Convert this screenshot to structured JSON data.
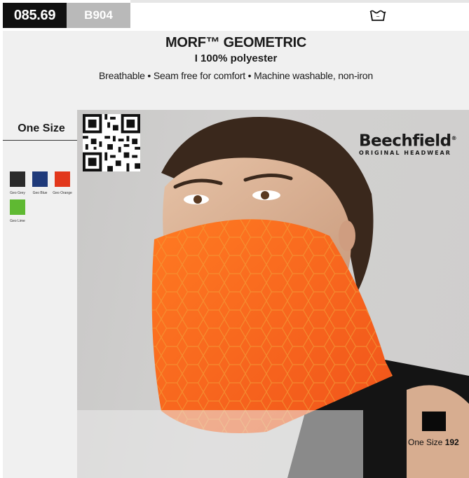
{
  "header": {
    "product_code": "085.69",
    "sku": "B904"
  },
  "product": {
    "title": "MORF™ GEOMETRIC",
    "material": "I 100% polyester",
    "features": "Breathable • Seam free for comfort • Machine washable, non-iron"
  },
  "sidebar": {
    "size_heading": "One Size",
    "colours": [
      {
        "name": "Geo Grey",
        "hex": "#2b2b2b"
      },
      {
        "name": "Geo Blue",
        "hex": "#1f3a7a"
      },
      {
        "name": "Geo Orange",
        "hex": "#e2371b"
      },
      {
        "name": "Geo Lime",
        "hex": "#5fb932"
      }
    ]
  },
  "brand": {
    "name": "Beechfield",
    "mark": "®",
    "tagline": "ORIGINAL HEADWEAR"
  },
  "packaging": {
    "size_label": "One Size",
    "quantity": "192"
  },
  "icons": {
    "care": "washing-icon",
    "qr": "qr-code-icon"
  }
}
